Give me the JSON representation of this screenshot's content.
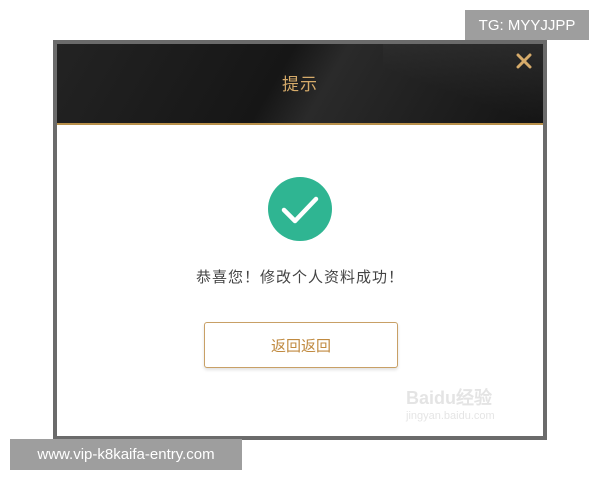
{
  "overlay": {
    "top_tag": "TG: MYYJJPP",
    "bottom_tag": "www.vip-k8kaifa-entry.com"
  },
  "dialog": {
    "title": "提示",
    "close_icon": "close-icon",
    "status_icon": "check-circle-icon",
    "message": "恭喜您！修改个人资料成功！",
    "button_label": "返回返回"
  },
  "watermark": {
    "brand": "Baidu经验",
    "url": "jingyan.baidu.com"
  },
  "colors": {
    "header_bg": "#1b1b1b",
    "gold": "#d6ab6a",
    "check_green": "#2fb592",
    "button_border": "#c8a066"
  }
}
